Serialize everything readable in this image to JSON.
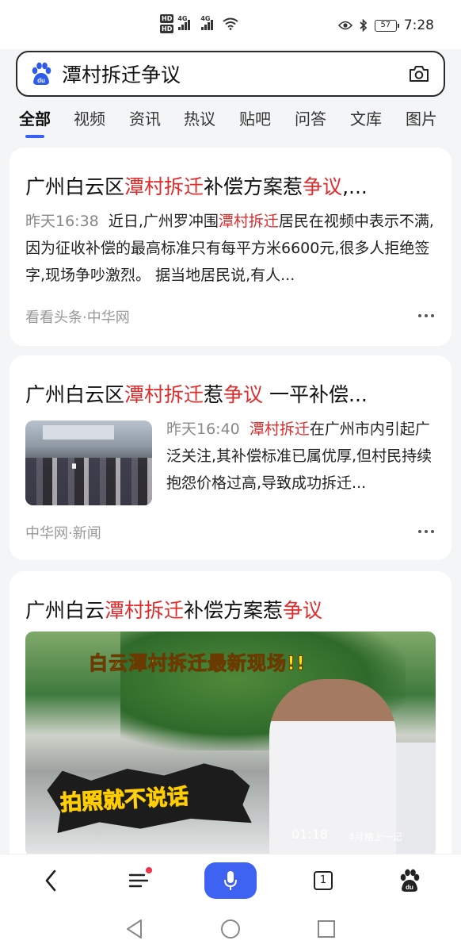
{
  "status_bar": {
    "hd1": "HD",
    "hd2": "HD",
    "net1": "4G",
    "net2": "4G",
    "battery": "57",
    "time": "7:28"
  },
  "search": {
    "query": "潭村拆迁争议"
  },
  "tabs": [
    {
      "label": "全部",
      "active": true
    },
    {
      "label": "视频"
    },
    {
      "label": "资讯"
    },
    {
      "label": "热议"
    },
    {
      "label": "贴吧"
    },
    {
      "label": "问答"
    },
    {
      "label": "文库"
    },
    {
      "label": "图片"
    }
  ],
  "results": [
    {
      "title": {
        "a": "广州白云区",
        "b": "潭村拆迁",
        "c": "补偿方案惹",
        "d": "争议",
        "e": ",..."
      },
      "time": "昨天16:38",
      "snippet": {
        "a": "近日,广州罗冲围",
        "b": "潭村拆迁",
        "c": "居民在视频中表示不满,因为征收补偿的最高标准只有每平方米6600元,很多人拒绝签字,现场争吵激烈。 据当地居民说,有人..."
      },
      "source": "看看头条·中华网"
    },
    {
      "title": {
        "a": "广州白云区",
        "b": "潭村拆迁",
        "c": "惹",
        "d": "争议",
        "e": " 一平补偿..."
      },
      "time": "昨天16:40",
      "snippet": {
        "b": "潭村拆迁",
        "c": "在广州市内引起广泛关注,其补偿标准已属优厚,但村民持续抱怨价格过高,导致成功拆迁..."
      },
      "source": "中华网·新闻",
      "thumb_overlay": "⏸"
    },
    {
      "title": {
        "a": "广州白云",
        "b": "潭村拆迁",
        "c": "补偿方案惹",
        "d": "争议"
      },
      "video": {
        "banner": "白云潭村拆迁最新现场!!",
        "sticker": "拍照就不说话",
        "duration": "01:18",
        "tag": "4月格上一记"
      }
    }
  ],
  "colors": {
    "highlight": "#e02b2b",
    "accent": "#3e63f3"
  },
  "icons": {
    "logo": "baidu-paw-icon",
    "camera": "camera-icon",
    "more": "more-dots-icon",
    "back": "back-arrow-icon",
    "menu": "menu-icon",
    "mic": "mic-icon",
    "tabs": "tabs-count-icon",
    "home": "baidu-home-icon"
  },
  "bottom_nav": {
    "tab_count": "1"
  }
}
